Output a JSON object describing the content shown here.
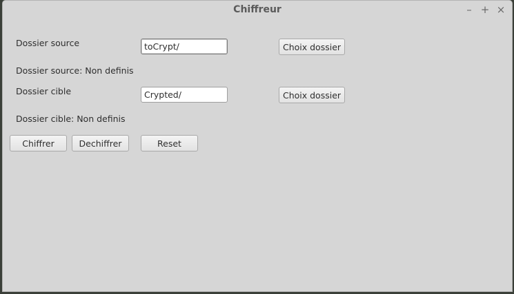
{
  "window": {
    "title": "Chiffreur",
    "controls": {
      "minimize": "–",
      "maximize": "+",
      "close": "×"
    }
  },
  "source": {
    "label": "Dossier source",
    "value": "toCrypt/",
    "choose_button": "Choix dossier",
    "status": "Dossier source: Non definis"
  },
  "target": {
    "label": "Dossier cible",
    "value": "Crypted/",
    "choose_button": "Choix dossier",
    "status": "Dossier cible: Non definis"
  },
  "actions": {
    "encrypt": "Chiffrer",
    "decrypt": "Dechiffrer",
    "reset": "Reset"
  }
}
